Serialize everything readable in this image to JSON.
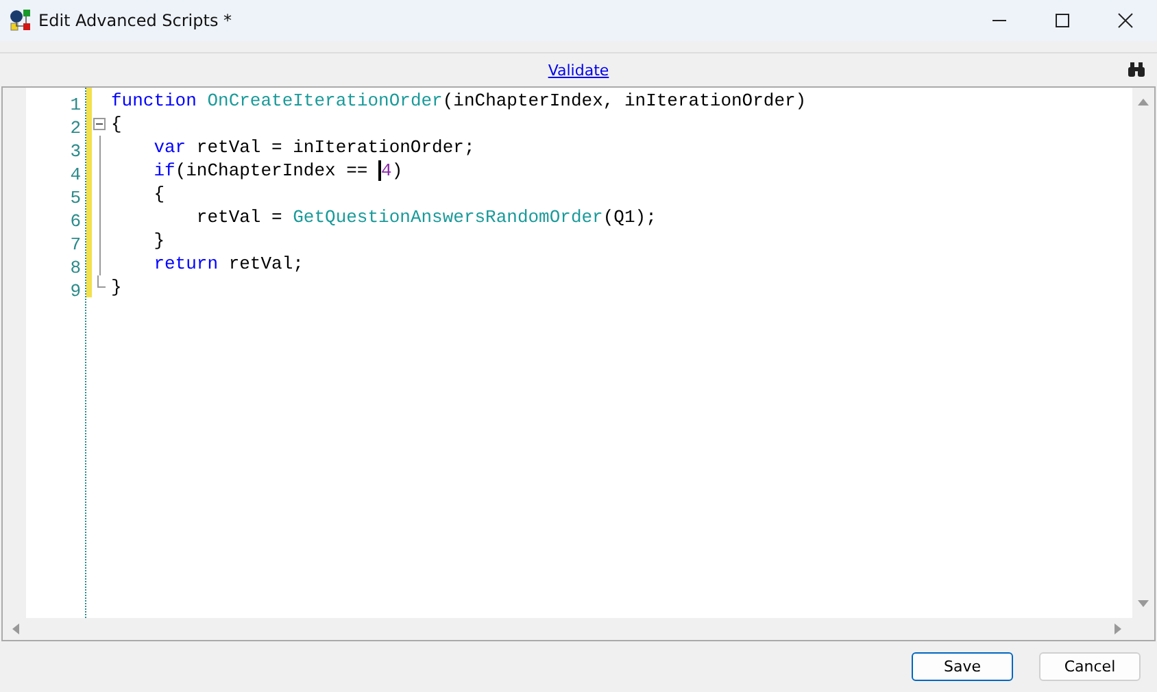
{
  "window": {
    "title": "Edit Advanced Scripts *"
  },
  "toolbar": {
    "validate_link": "Validate"
  },
  "code_lines": [
    {
      "number": "1",
      "kind": "plain",
      "tokens": [
        {
          "kind": "keyword",
          "text": "function"
        },
        {
          "kind": "function",
          "text": " OnCreateIterationOrder"
        },
        {
          "kind": "plain",
          "text": "(inChapterIndex, inIterationOrder)"
        }
      ]
    },
    {
      "number": "2",
      "kind": "fold_start",
      "tokens": [
        {
          "kind": "plain",
          "text": "{"
        }
      ]
    },
    {
      "number": "3",
      "kind": "fold_inner",
      "tokens": [
        {
          "kind": "keyword",
          "text": "    var"
        },
        {
          "kind": "plain",
          "text": " retVal = inIterationOrder;"
        }
      ]
    },
    {
      "number": "4",
      "kind": "fold_inner",
      "tokens": [
        {
          "kind": "keyword",
          "text": "    if"
        },
        {
          "kind": "plain",
          "text": "(inChapterIndex == "
        },
        {
          "kind": "caret"
        },
        {
          "kind": "number",
          "text": "4"
        },
        {
          "kind": "plain",
          "text": ")"
        }
      ]
    },
    {
      "number": "5",
      "kind": "fold_inner",
      "tokens": [
        {
          "kind": "plain",
          "text": "    {"
        }
      ]
    },
    {
      "number": "6",
      "kind": "fold_inner",
      "tokens": [
        {
          "kind": "plain",
          "text": "        retVal = "
        },
        {
          "kind": "function",
          "text": "GetQuestionAnswersRandomOrder"
        },
        {
          "kind": "plain",
          "text": "(Q1);"
        }
      ]
    },
    {
      "number": "7",
      "kind": "fold_inner",
      "tokens": [
        {
          "kind": "plain",
          "text": "    }"
        }
      ]
    },
    {
      "number": "8",
      "kind": "fold_inner",
      "tokens": [
        {
          "kind": "keyword",
          "text": "    return"
        },
        {
          "kind": "plain",
          "text": " retVal;"
        }
      ]
    },
    {
      "number": "9",
      "kind": "fold_end",
      "tokens": [
        {
          "kind": "plain",
          "text": "}"
        }
      ]
    }
  ],
  "buttons": [
    {
      "label": "Save",
      "kind": "default"
    },
    {
      "label": "Cancel",
      "kind": "normal"
    }
  ]
}
